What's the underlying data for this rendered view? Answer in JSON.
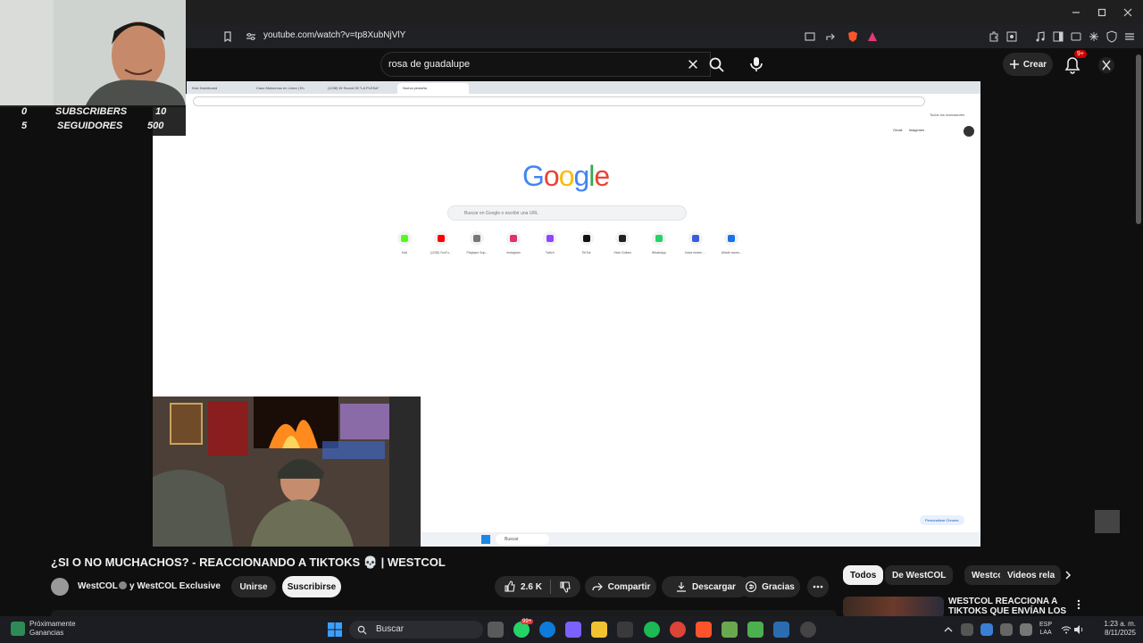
{
  "browser": {
    "url": "youtube.com/watch?v=tp8XubNjVlY"
  },
  "youtube_header": {
    "search_value": "rosa de guadalupe",
    "create_label": "Crear",
    "notifications_badge": "9+"
  },
  "stream_overlay": {
    "subscribers_count": "0",
    "subscribers_label": "SUBSCRIBERS",
    "subscribers_goal": "10",
    "followers_count": "5",
    "followers_label": "SEGUIDORES",
    "followers_goal": "500"
  },
  "video_content": {
    "google_logo_letters": [
      "G",
      "o",
      "o",
      "g",
      "l",
      "e"
    ],
    "google_logo_colors": [
      "#4285F4",
      "#EA4335",
      "#FBBC05",
      "#4285F4",
      "#34A853",
      "#EA4335"
    ],
    "search_placeholder": "Buscar en Google o escribir una URL",
    "tabs": [
      "Kick Dashboard",
      "Caso Motocross en Línea | En",
      "(1238) W Sound 05 \"LA PLENA\"",
      "Nueva pestaña"
    ],
    "top_links": [
      "Gmail",
      "Imágenes"
    ],
    "bookmarks_label": "Todos los marcadores",
    "shortcuts": [
      {
        "label": "Kick",
        "color": "#53fc18"
      },
      {
        "label": "(1238) YouTu...",
        "color": "#ff0000"
      },
      {
        "label": "Playtape Sup...",
        "color": "#777777"
      },
      {
        "label": "Instagram",
        "color": "#e1306c"
      },
      {
        "label": "Twitch",
        "color": "#9146ff"
      },
      {
        "label": "TikTok",
        "color": "#111111"
      },
      {
        "label": "Stoic Dollars",
        "color": "#222222"
      },
      {
        "label": "WhatsApp",
        "color": "#25d366"
      },
      {
        "label": "Inicia sesión ...",
        "color": "#3b5bdb"
      },
      {
        "label": "Añadir acces...",
        "color": "#1a73e8"
      }
    ],
    "customize_label": "Personalizar Chrome",
    "inner_search": "Buscar"
  },
  "video_info": {
    "title": "¿SI O NO MUCHACHOS? - REACCIONANDO A TIKTOKS 💀 | WESTCOL",
    "channel": "WestCOL",
    "channel_suffix": "y WestCOL Exclusive",
    "join_label": "Unirse",
    "subscribe_label": "Suscribirse",
    "likes": "2.6 K",
    "share_label": "Compartir",
    "download_label": "Descargar",
    "thanks_label": "Gracias"
  },
  "recommendations": {
    "chips": [
      "Todos",
      "De WestCOL",
      "Westcol",
      "Videos rela"
    ],
    "first_title": "WESTCOL REACCIONA A TIKTOKS QUE ENVÍAN LOS"
  },
  "taskbar": {
    "weather_title": "Próximamente",
    "weather_sub": "Ganancias",
    "search_label": "Buscar",
    "whatsapp_badge": "99+",
    "lang_top": "ESP",
    "lang_bottom": "LAA",
    "time": "1:23 a. m.",
    "date": "8/11/2025"
  }
}
